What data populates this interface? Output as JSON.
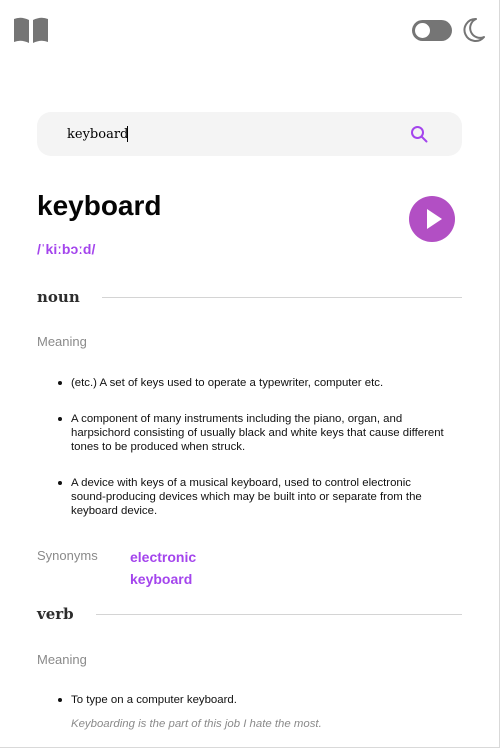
{
  "header": {
    "logo_icon": "book-icon",
    "theme_toggle_icon": "toggle-icon",
    "theme_icon": "moon-icon"
  },
  "search": {
    "value": "keyboard",
    "icon": "search-icon"
  },
  "entry": {
    "word": "keyboard",
    "phonetic": "/ˈkiːbɔːd/",
    "play_icon": "play-icon",
    "accent_color": "#a445ed"
  },
  "meanings": [
    {
      "part_of_speech": "noun",
      "meaning_label": "Meaning",
      "definitions": [
        "(etc.) A set of keys used to operate a typewriter, computer etc.",
        "A component of many instruments including the piano, organ, and harpsichord consisting of usually black and white keys that cause different tones to be produced when struck.",
        "A device with keys of a musical keyboard, used to control electronic sound-producing devices which may be built into or separate from the keyboard device."
      ],
      "synonyms_label": "Synonyms",
      "synonyms": [
        "electronic",
        "keyboard"
      ]
    },
    {
      "part_of_speech": "verb",
      "meaning_label": "Meaning",
      "definitions": [
        "To type on a computer keyboard."
      ],
      "example": "Keyboarding is the part of this job I hate the most."
    }
  ]
}
